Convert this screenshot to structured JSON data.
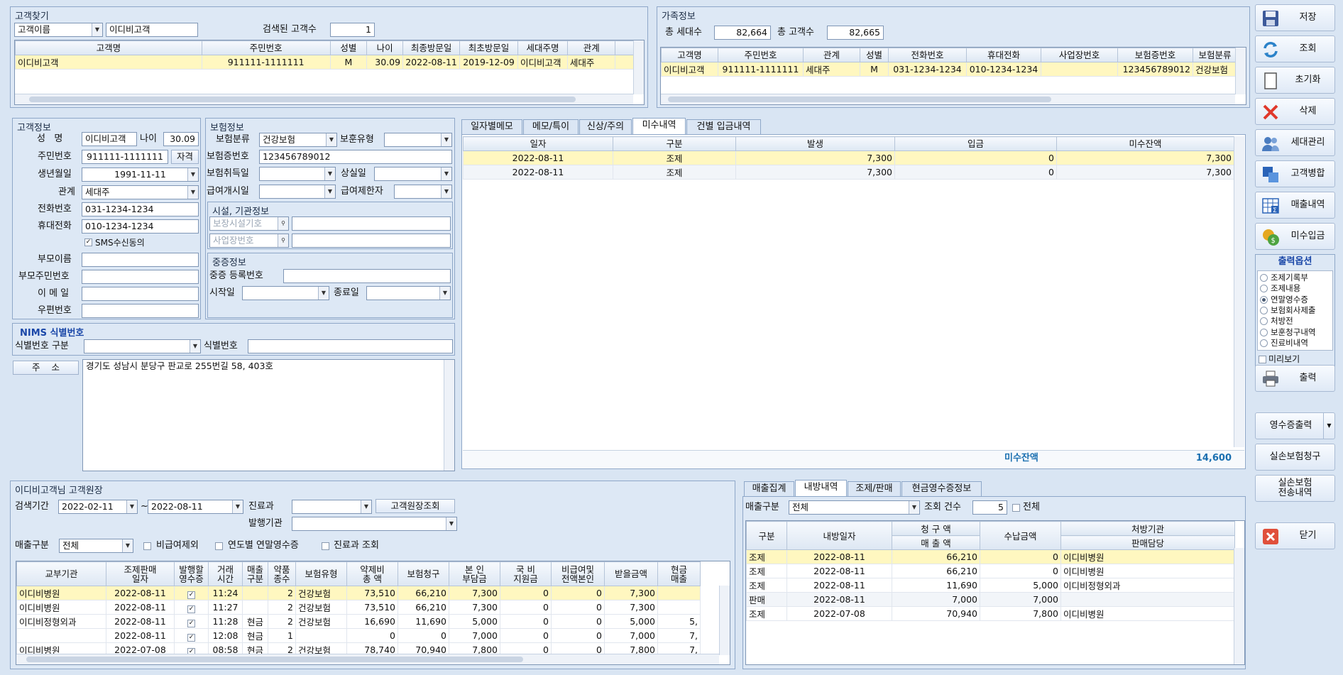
{
  "search": {
    "title": "고객찾기",
    "type_value": "고객이름",
    "keyword": "이디비고객",
    "found_label": "검색된 고객수",
    "found_count": "1",
    "columns": [
      "고객명",
      "주민번호",
      "성별",
      "나이",
      "최종방문일",
      "최초방문일",
      "세대주명",
      "관계"
    ],
    "rows": [
      [
        "이디비고객",
        "911111-1111111",
        "M",
        "30.09",
        "2022-08-11",
        "2019-12-09",
        "이디비고객",
        "세대주"
      ]
    ]
  },
  "family": {
    "title": "가족정보",
    "households_label": "총 세대수",
    "households": "82,664",
    "customers_label": "총 고객수",
    "customers": "82,665",
    "columns": [
      "고객명",
      "주민번호",
      "관계",
      "성별",
      "전화번호",
      "휴대전화",
      "사업장번호",
      "보험증번호",
      "보험분류"
    ],
    "rows": [
      [
        "이디비고객",
        "911111-1111111",
        "세대주",
        "M",
        "031-1234-1234",
        "010-1234-1234",
        "",
        "123456789012",
        "건강보험"
      ]
    ]
  },
  "customer": {
    "title": "고객정보",
    "name_label": "성   명",
    "name": "이디비고객",
    "age_label": "나이",
    "age": "30.09",
    "rrn_label": "주민번호",
    "rrn": "911111-1111111",
    "qual_button": "자격",
    "birth_label": "생년월일",
    "birth": "1991-11-11",
    "relation_label": "관계",
    "relation": "세대주",
    "phone_label": "전화번호",
    "phone": "031-1234-1234",
    "mobile_label": "휴대전화",
    "mobile": "010-1234-1234",
    "sms_label": "SMS수신동의",
    "parent_name_label": "부모이름",
    "parent_rrn_label": "부모주민번호",
    "email_label": "이 메 일",
    "zip_label": "우편번호"
  },
  "insurance": {
    "title": "보험정보",
    "class_label": "보험분류",
    "class_value": "건강보험",
    "veteran_label": "보훈유형",
    "card_label": "보험증번호",
    "card_no": "123456789012",
    "acquire_label": "보험취득일",
    "lost_label": "상실일",
    "benefit_start_label": "급여개시일",
    "benefit_limit_label": "급여제한자",
    "facility_title": "시설, 기관정보",
    "facility_ph": "보장시설기호",
    "workplace_ph": "사업장번호",
    "severe_title": "중증정보",
    "severe_reg_label": "중증 등록번호",
    "start_label": "시작일",
    "end_label": "종료일"
  },
  "nims": {
    "title": "NIMS 식별번호",
    "type_label": "식별번호 구분",
    "no_label": "식별번호"
  },
  "address": {
    "label": "주    소",
    "value": "경기도 성남시 분당구 판교로 255번길 58, 403호"
  },
  "receivable": {
    "tabs": [
      "일자별메모",
      "메모/특이",
      "신상/주의",
      "미수내역",
      "건별 입금내역"
    ],
    "active_tab": 3,
    "columns": [
      "일자",
      "구분",
      "발생",
      "입금",
      "미수잔액"
    ],
    "rows": [
      [
        "2022-08-11",
        "조제",
        "7,300",
        "0",
        "7,300"
      ],
      [
        "2022-08-11",
        "조제",
        "7,300",
        "0",
        "7,300"
      ]
    ],
    "total_label": "미수잔액",
    "total_value": "14,600"
  },
  "ledger": {
    "title": "이디비고객님 고객원장",
    "period_label": "검색기간",
    "from": "2022-02-11",
    "tilde": "~",
    "to": "2022-08-11",
    "dept_label": "진료과",
    "query_button": "고객원장조회",
    "issuer_label": "발행기관",
    "sales_type_label": "매출구분",
    "sales_type": "전체",
    "opt1": "비급여제외",
    "opt2": "연도별 연말영수증",
    "opt3": "진료과 조회",
    "columns": [
      "교부기관",
      "조제판매\n일자",
      "발행할\n영수증",
      "거래\n시간",
      "매출\n구분",
      "약품\n종수",
      "보험유형",
      "약제비\n총 액",
      "보험청구",
      "본 인\n부담금",
      "국 비\n지원금",
      "비급여및\n전액본인",
      "받을금액",
      "현금\n매출"
    ],
    "rows": [
      [
        "이디비병원",
        "2022-08-11",
        "✓",
        "11:24",
        "",
        "2",
        "건강보험",
        "73,510",
        "66,210",
        "7,300",
        "0",
        "0",
        "7,300",
        ""
      ],
      [
        "이디비병원",
        "2022-08-11",
        "✓",
        "11:27",
        "",
        "2",
        "건강보험",
        "73,510",
        "66,210",
        "7,300",
        "0",
        "0",
        "7,300",
        ""
      ],
      [
        "이디비정형외과",
        "2022-08-11",
        "✓",
        "11:28",
        "현금",
        "2",
        "건강보험",
        "16,690",
        "11,690",
        "5,000",
        "0",
        "0",
        "5,000",
        "5,"
      ],
      [
        "",
        "2022-08-11",
        "✓",
        "12:08",
        "현금",
        "1",
        "",
        "0",
        "0",
        "7,000",
        "0",
        "0",
        "7,000",
        "7,"
      ],
      [
        "이디비병원",
        "2022-07-08",
        "✓",
        "08:58",
        "현금",
        "2",
        "건강보험",
        "78,740",
        "70,940",
        "7,800",
        "0",
        "0",
        "7,800",
        "7,"
      ]
    ]
  },
  "sales": {
    "tabs": [
      "매출집계",
      "내방내역",
      "조제/판매",
      "현금영수증정보"
    ],
    "active_tab": 1,
    "type_label": "매출구분",
    "type_value": "전체",
    "count_label": "조회 건수",
    "count": "5",
    "all_label": "전체",
    "columns": [
      "구분",
      "내방일자",
      "청 구 액",
      "매 출 액",
      "수납금액",
      "처방기관",
      "판매담당"
    ],
    "rows": [
      [
        "조제",
        "2022-08-11",
        "66,210",
        "0",
        "이디비병원"
      ],
      [
        "조제",
        "2022-08-11",
        "66,210",
        "0",
        "이디비병원"
      ],
      [
        "조제",
        "2022-08-11",
        "11,690",
        "5,000",
        "이디비정형외과"
      ],
      [
        "판매",
        "2022-08-11",
        "7,000",
        "7,000",
        ""
      ],
      [
        "조제",
        "2022-07-08",
        "70,940",
        "7,800",
        "이디비병원"
      ]
    ]
  },
  "side": {
    "save": "저장",
    "query": "조회",
    "reset": "초기화",
    "delete": "삭제",
    "household": "세대관리",
    "merge": "고객병합",
    "sales": "매출내역",
    "receive": "미수입금",
    "print_opt_title": "출력옵션",
    "print_opts": [
      "조제기록부",
      "조제내용",
      "연말영수증",
      "보험회사제출",
      "처방전",
      "보훈청구내역",
      "진료비내역"
    ],
    "print_opt_selected": 2,
    "preview": "미리보기",
    "print": "출력",
    "receipt_print": "영수증출력",
    "claim": "실손보험청구",
    "claim_history": "실손보험\n전송내역",
    "close": "닫기"
  }
}
